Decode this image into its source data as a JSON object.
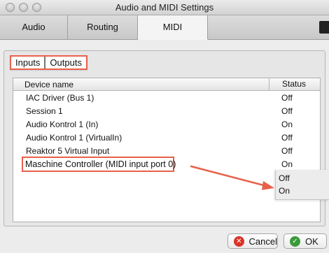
{
  "window": {
    "title": "Audio and MIDI Settings"
  },
  "tabs": [
    {
      "label": "Audio",
      "active": false
    },
    {
      "label": "Routing",
      "active": false
    },
    {
      "label": "MIDI",
      "active": true
    }
  ],
  "segment": {
    "inputs_label": "Inputs",
    "outputs_label": "Outputs"
  },
  "table": {
    "headers": {
      "name": "Device name",
      "status": "Status"
    },
    "rows": [
      {
        "name": "IAC Driver (Bus 1)",
        "status": "Off"
      },
      {
        "name": "Session 1",
        "status": "Off"
      },
      {
        "name": "Audio Kontrol 1 (In)",
        "status": "On"
      },
      {
        "name": "Audio Kontrol 1 (VirtualIn)",
        "status": "Off"
      },
      {
        "name": "Reaktor 5 Virtual Input",
        "status": "Off"
      },
      {
        "name": "Maschine Controller (MIDI input port 0)",
        "status": "On"
      }
    ]
  },
  "status_popup": {
    "options": [
      "Off",
      "On"
    ]
  },
  "buttons": {
    "cancel_label": "Cancel",
    "ok_label": "OK"
  },
  "colors": {
    "annotation": "#e8604c",
    "cancel_icon": "#d9342b",
    "ok_icon": "#3a9a3a"
  }
}
